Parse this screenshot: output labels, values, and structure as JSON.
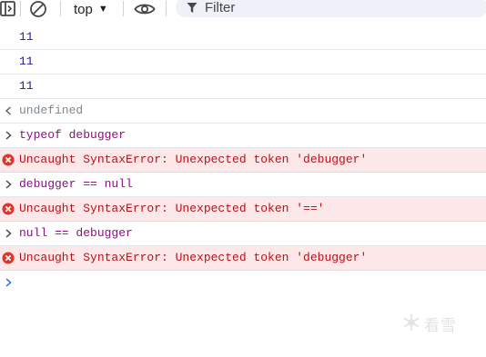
{
  "toolbar": {
    "context_label": "top",
    "filter_placeholder": "Filter",
    "icons": [
      "sidebar-toggle-icon",
      "clear-console-icon",
      "chevron-down-icon",
      "eye-icon",
      "funnel-icon"
    ]
  },
  "console": {
    "rows": [
      {
        "kind": "output",
        "text": "11"
      },
      {
        "kind": "output",
        "text": "11"
      },
      {
        "kind": "output",
        "text": "11"
      },
      {
        "kind": "result",
        "text": "undefined"
      },
      {
        "kind": "input",
        "text": "typeof debugger"
      },
      {
        "kind": "error",
        "text": "Uncaught SyntaxError: Unexpected token 'debugger'"
      },
      {
        "kind": "input",
        "text": "debugger == null"
      },
      {
        "kind": "error",
        "text": "Uncaught SyntaxError: Unexpected token '=='"
      },
      {
        "kind": "input",
        "text": "null == debugger"
      },
      {
        "kind": "error",
        "text": "Uncaught SyntaxError: Unexpected token 'debugger'"
      }
    ]
  },
  "watermark": {
    "text": "看雪"
  },
  "colors": {
    "number": "#1a1aa6",
    "input_code": "#881280",
    "error_text": "#b5141b",
    "error_bg": "#fce8e8",
    "muted": "#80868b",
    "prompt_arrow": "#1a73e8"
  }
}
